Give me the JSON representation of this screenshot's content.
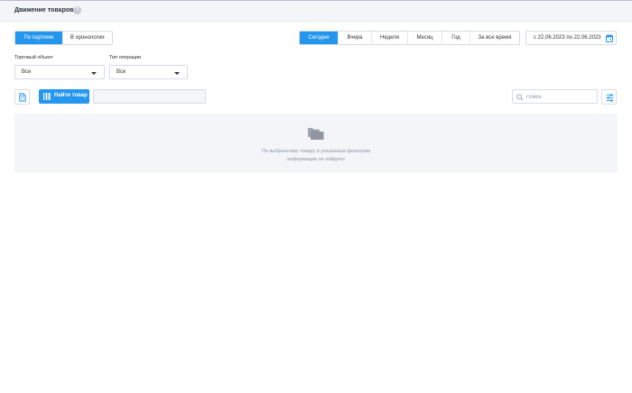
{
  "header": {
    "title": "Движение товаров",
    "help_icon": "question-circle-icon"
  },
  "view_mode": {
    "options": [
      "По партиям",
      "В хронологии"
    ],
    "selected": "По партиям"
  },
  "period": {
    "options": [
      "Сегодня",
      "Вчера",
      "Неделя",
      "Месяц",
      "Год",
      "За все время"
    ],
    "selected": "Сегодня"
  },
  "date_range": {
    "text": "с 22.06.2023  по 22.06.2023",
    "icon": "calendar-icon"
  },
  "filters": {
    "trade_object": {
      "label": "Торговый объект",
      "value": "Все"
    },
    "operation_type": {
      "label": "Тип операции",
      "value": "Все"
    }
  },
  "toolbar": {
    "document_icon": "document-icon",
    "find_product_label": "Найти товар",
    "find_product_icon": "barcode-icon",
    "product_value": "",
    "search_placeholder": "Поиск",
    "search_icon": "search-icon",
    "settings_icon": "sliders-icon"
  },
  "empty_state": {
    "icon": "folders-icon",
    "line1": "По выбранному товару и указанным фильтрам",
    "line2": "информации не найдено"
  },
  "colors": {
    "accent": "#2496ee",
    "header_bg": "#f3f5f9",
    "panel_bg": "#f3f5f8",
    "muted_text": "#8e95a3",
    "border": "#d7dce4"
  }
}
